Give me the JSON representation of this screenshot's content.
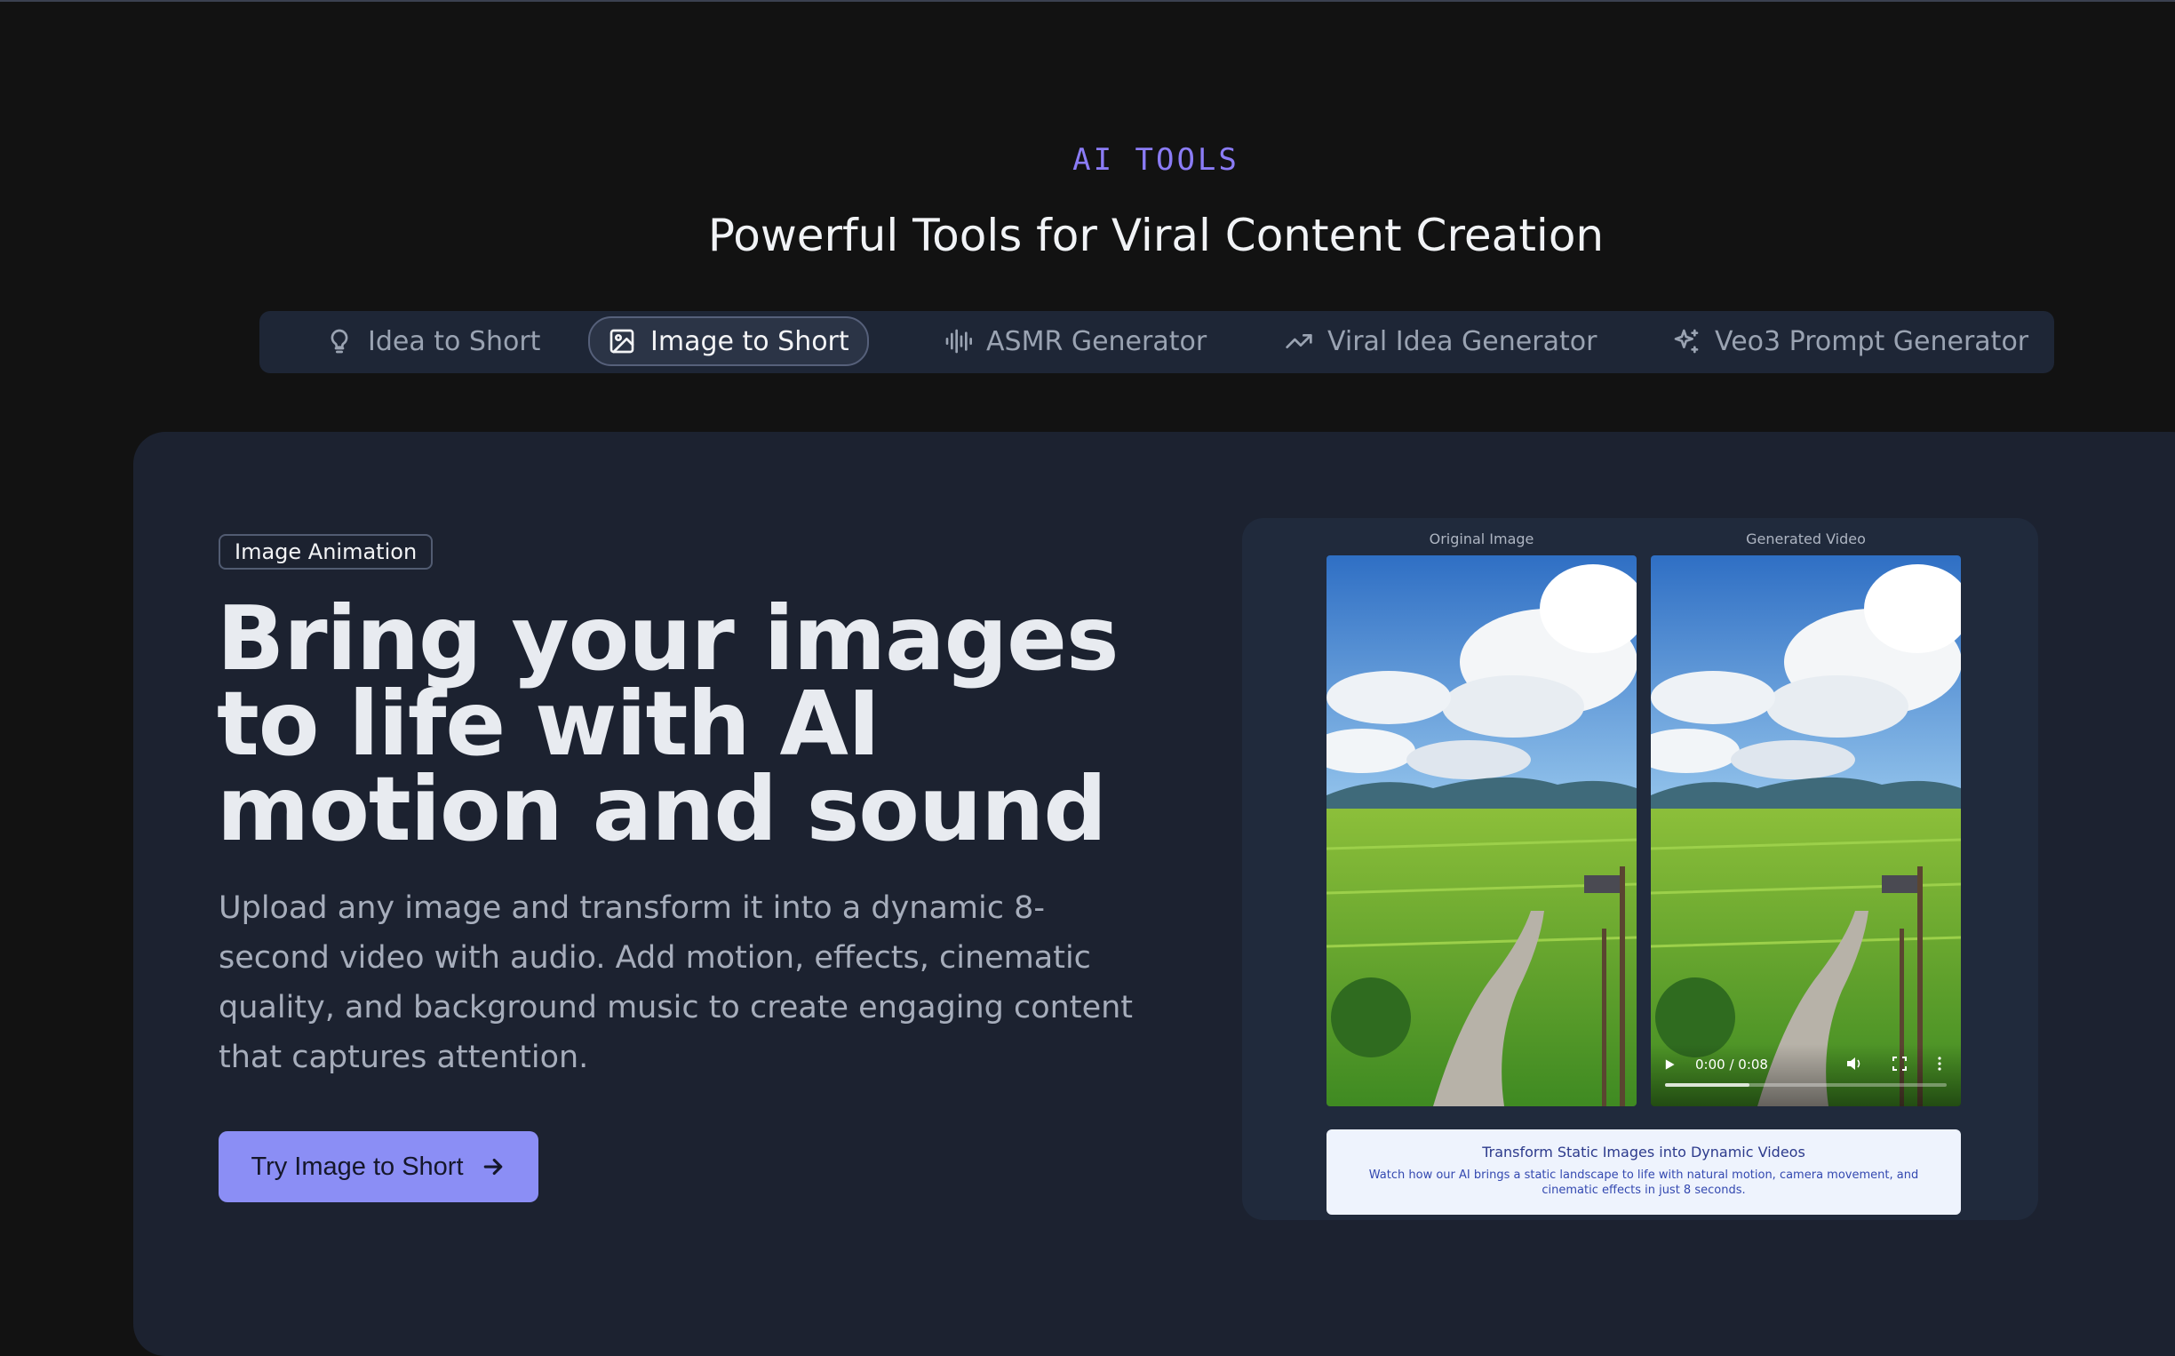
{
  "section": {
    "eyebrow": "AI TOOLS",
    "title": "Powerful Tools for Viral Content Creation"
  },
  "tabs": [
    {
      "label": "Idea to Short",
      "icon": "lightbulb-icon",
      "active": false
    },
    {
      "label": "Image to Short",
      "icon": "image-icon",
      "active": true
    },
    {
      "label": "ASMR Generator",
      "icon": "audio-waveform-icon",
      "active": false
    },
    {
      "label": "Viral Idea Generator",
      "icon": "trending-up-icon",
      "active": false
    },
    {
      "label": "Veo3 Prompt Generator",
      "icon": "sparkles-icon",
      "active": false
    }
  ],
  "feature": {
    "badge": "Image Animation",
    "headline": "Bring your images to life with AI motion and sound",
    "description": "Upload any image and transform it into a dynamic 8-second video with audio. Add motion, effects, cinematic quality, and background music to create engaging content that captures attention.",
    "cta_label": "Try Image to Short",
    "cta_icon": "arrow-right-icon"
  },
  "demo": {
    "original_label": "Original Image",
    "generated_label": "Generated Video",
    "video": {
      "time": "0:00 / 0:08",
      "buffered_fraction": 0.3
    },
    "caption_title": "Transform Static Images into Dynamic Videos",
    "caption_text": "Watch how our AI brings a static landscape to life with natural motion, camera movement, and cinematic effects in just 8 seconds."
  },
  "colors": {
    "background": "#121212",
    "card": "#1c2230",
    "accent": "#8b7cf6",
    "cta": "#8b8ef5"
  }
}
